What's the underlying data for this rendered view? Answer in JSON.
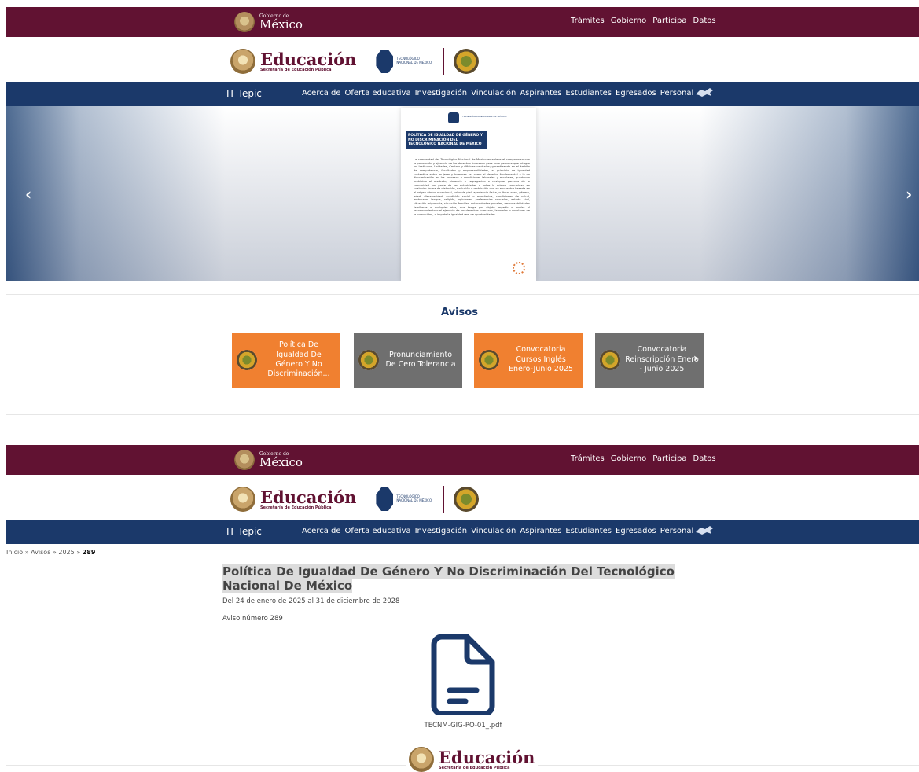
{
  "gov": {
    "brand_small": "Gobierno de",
    "brand_big": "México",
    "nav": [
      "Trámites",
      "Gobierno",
      "Participa",
      "Datos"
    ]
  },
  "edu": {
    "name": "Educación",
    "subtitle": "Secretaría de Educación Pública",
    "tecnm": "TECNOLÓGICO NACIONAL DE MÉXICO"
  },
  "it": {
    "brand": "IT Tepic",
    "nav": [
      "Acerca de",
      "Oferta educativa",
      "Investigación",
      "Vinculación",
      "Aspirantes",
      "Estudiantes",
      "Egresados",
      "Personal"
    ]
  },
  "carousel": {
    "prev": "‹",
    "next": "›",
    "slide_title": "POLÍTICA DE IGUALDAD DE GÉNERO Y NO DISCRIMINACIÓN DEL TECNOLÓGICO NACIONAL DE MÉXICO",
    "slide_body": "La comunidad del Tecnológico Nacional de México establece el compromiso con la promoción y ejercicio de los derechos humanos para toda persona que integra los Institutos, Unidades, Centros y Oficinas centrales; garantizando en el ámbito de competencia, facultades y responsabilidades, el principio de igualdad sustantiva entre mujeres y hombres así como el derecho fundamental a la no discriminación en los procesos y condiciones laborales y escolares, quedando prohibido el maltrato, violencia y segregación a cualquier persona de la comunidad por parte de las autoridades o entre la misma comunidad en cualquier forma de distinción, exclusión o restricción que se encuentre basada en el origen étnico o nacional, color de piel, apariencia física, cultura, sexo, género, edad, discapacidad, condición social o económica, condiciones de salud, embarazo, lengua, religión, opiniones, preferencias sexuales, estado civil, situación migratoria, situación familiar, antecedentes penales, responsabilidades familiares o cualquier otra, que tenga por objeto impedir o anular el reconocimiento o el ejercicio de los derechos humanos, laborales o escolares de la comunidad, o impida la igualdad real de oportunidades."
  },
  "avisos": {
    "title": "Avisos",
    "cards": [
      {
        "text": "Política De Igualdad De Género Y No Discriminación...",
        "color": "#f08030"
      },
      {
        "text": "Pronunciamiento De Cero Tolerancia",
        "color": "#6f6f6f"
      },
      {
        "text": "Convocatoria Cursos Inglés Enero-Junio 2025",
        "color": "#f08030"
      },
      {
        "text": "Convocatoria Reinscripción Enero - Junio 2025",
        "color": "#6f6f6f"
      }
    ],
    "next": "›"
  },
  "detail": {
    "breadcrumb": [
      "Inicio",
      "Avisos",
      "2025"
    ],
    "breadcrumb_current": "289",
    "breadcrumb_sep": "»",
    "title": "Política De Igualdad De Género Y No Discriminación Del Tecnológico Nacional De México",
    "date_range": "Del 24 de enero de 2025 al 31 de diciembre de 2028",
    "aviso_number": "Aviso número 289",
    "file_name": "TECNM-GIG-PO-01_.pdf"
  },
  "colors": {
    "gov": "#611232",
    "it": "#1b396a",
    "orange": "#f08030",
    "gray": "#6f6f6f"
  }
}
